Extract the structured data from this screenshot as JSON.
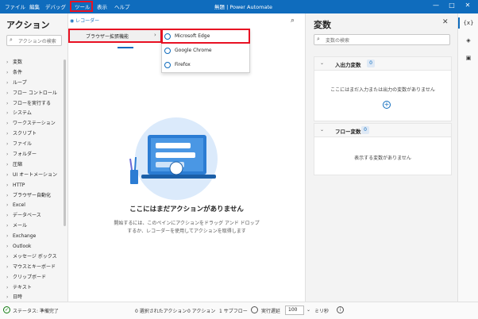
{
  "menubar": {
    "items": [
      "ファイル",
      "編集",
      "デバッグ",
      "ツール",
      "表示",
      "ヘルプ"
    ]
  },
  "window": {
    "title": "無題 | Power Automate",
    "minimize": "—",
    "maximize": "□",
    "close": "✕"
  },
  "actions_panel": {
    "title": "アクション",
    "search_placeholder": "アクションの検索",
    "categories": [
      "変数",
      "条件",
      "ループ",
      "フロー コントロール",
      "フローを実行する",
      "システム",
      "ワークステーション",
      "スクリプト",
      "ファイル",
      "フォルダー",
      "圧縮",
      "UI オートメーション",
      "HTTP",
      "ブラウザー自動化",
      "Excel",
      "データベース",
      "メール",
      "Exchange",
      "Outlook",
      "メッセージ ボックス",
      "マウスとキーボード",
      "クリップボード",
      "テキスト",
      "日時"
    ]
  },
  "toolbar": {
    "recorder": "レコーダー"
  },
  "tools_menu": {
    "browser_extensions": "ブラウザー拡張機能",
    "arrow": "›"
  },
  "browser_flyout": {
    "items": [
      "Microsoft Edge",
      "Google Chrome",
      "Firefox"
    ]
  },
  "canvas": {
    "empty_title": "ここにはまだアクションがありません",
    "empty_line1": "開始するには、このペインにアクションをドラッグ アンド ドロップ",
    "empty_line2": "するか、レコーダーを使用してアクションを取得します"
  },
  "variables_panel": {
    "title": "変数",
    "close": "✕",
    "search_placeholder": "変数の検索",
    "io_section": {
      "title": "入出力変数",
      "count": "0",
      "message": "ここにはまだ入力または出力の変数がありません",
      "add": "+"
    },
    "flow_section": {
      "title": "フロー変数",
      "count": "0",
      "message": "表示する変数がありません"
    }
  },
  "rail": {
    "variables_icon": "{x}"
  },
  "statusbar": {
    "status": "ステータス: 準備完了",
    "selected": "0 選択されたアクション",
    "actions": "0 アクション",
    "subflows": "1 サブフロー",
    "delay_label": "実行遅延",
    "delay_value": "100",
    "unit": "ミリ秒"
  },
  "colors": {
    "accent": "#0f6cbd",
    "highlight": "#e81123"
  }
}
